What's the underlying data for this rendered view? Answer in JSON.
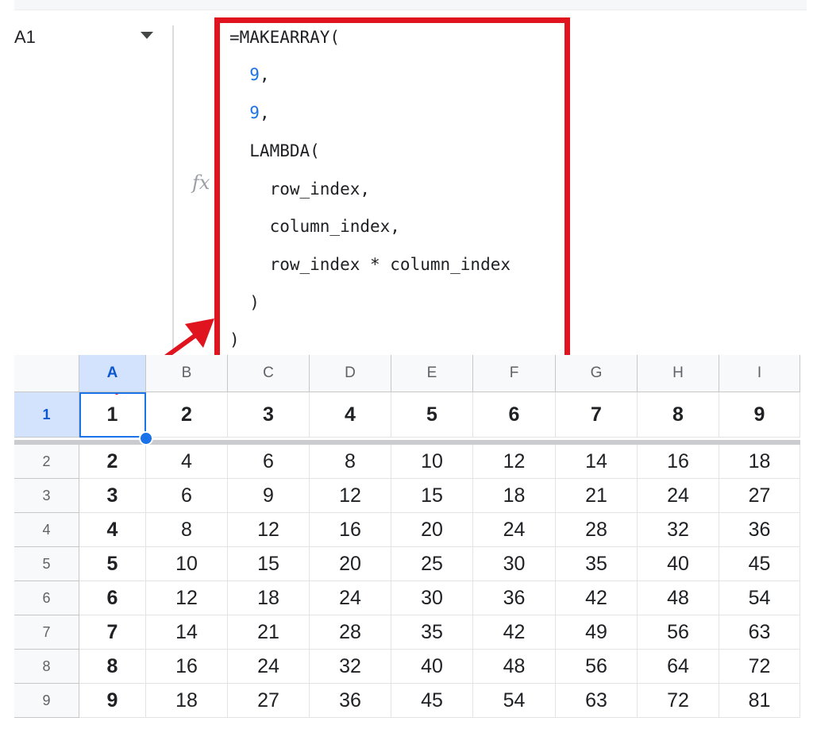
{
  "name_box": {
    "value": "A1"
  },
  "formula_bar": {
    "fx_label": "fx",
    "lines": [
      {
        "pre": "=MAKEARRAY(",
        "num": "",
        "post": ""
      },
      {
        "pre": "  ",
        "num": "9",
        "post": ","
      },
      {
        "pre": "  ",
        "num": "9",
        "post": ","
      },
      {
        "pre": "  LAMBDA(",
        "num": "",
        "post": ""
      },
      {
        "pre": "    row_index,",
        "num": "",
        "post": ""
      },
      {
        "pre": "    column_index,",
        "num": "",
        "post": ""
      },
      {
        "pre": "    row_index * column_index",
        "num": "",
        "post": ""
      },
      {
        "pre": "  )",
        "num": "",
        "post": ""
      },
      {
        "pre": ")",
        "num": "",
        "post": ""
      }
    ]
  },
  "grid": {
    "column_headers": [
      "A",
      "B",
      "C",
      "D",
      "E",
      "F",
      "G",
      "H",
      "I"
    ],
    "selected_column": "A",
    "selected_row": "1",
    "rows": [
      {
        "label": "1",
        "cells": [
          "1",
          "2",
          "3",
          "4",
          "5",
          "6",
          "7",
          "8",
          "9"
        ]
      },
      {
        "label": "2",
        "cells": [
          "2",
          "4",
          "6",
          "8",
          "10",
          "12",
          "14",
          "16",
          "18"
        ]
      },
      {
        "label": "3",
        "cells": [
          "3",
          "6",
          "9",
          "12",
          "15",
          "18",
          "21",
          "24",
          "27"
        ]
      },
      {
        "label": "4",
        "cells": [
          "4",
          "8",
          "12",
          "16",
          "20",
          "24",
          "28",
          "32",
          "36"
        ]
      },
      {
        "label": "5",
        "cells": [
          "5",
          "10",
          "15",
          "20",
          "25",
          "30",
          "35",
          "40",
          "45"
        ]
      },
      {
        "label": "6",
        "cells": [
          "6",
          "12",
          "18",
          "24",
          "30",
          "36",
          "42",
          "48",
          "54"
        ]
      },
      {
        "label": "7",
        "cells": [
          "7",
          "14",
          "21",
          "28",
          "35",
          "42",
          "49",
          "56",
          "63"
        ]
      },
      {
        "label": "8",
        "cells": [
          "8",
          "16",
          "24",
          "32",
          "40",
          "48",
          "56",
          "64",
          "72"
        ]
      },
      {
        "label": "9",
        "cells": [
          "9",
          "18",
          "27",
          "36",
          "45",
          "54",
          "63",
          "72",
          "81"
        ]
      }
    ]
  },
  "colors": {
    "highlight_border": "#e0141e",
    "selection": "#1a73e8",
    "header_selected_bg": "#d3e3fd"
  }
}
